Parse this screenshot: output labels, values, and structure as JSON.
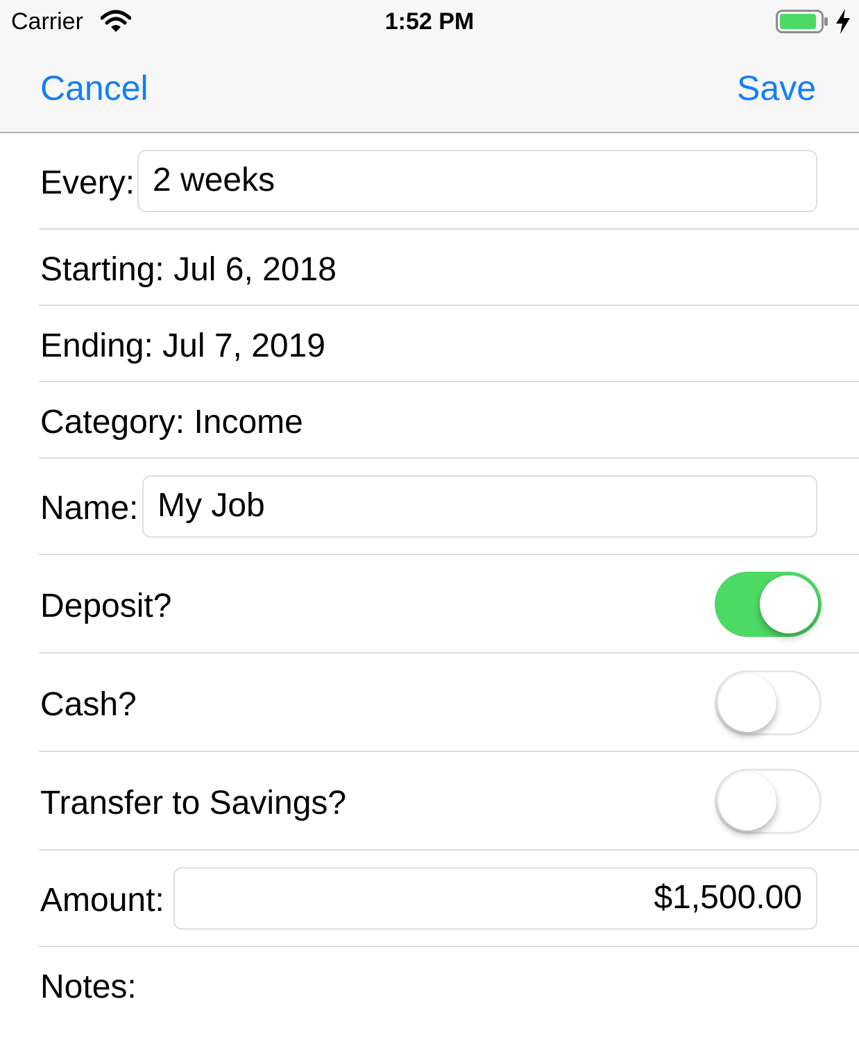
{
  "status": {
    "carrier": "Carrier",
    "time": "1:52 PM"
  },
  "nav": {
    "cancel": "Cancel",
    "save": "Save"
  },
  "form": {
    "every": {
      "label": "Every:",
      "value": "2 weeks"
    },
    "starting": {
      "label": "Starting: Jul 6, 2018"
    },
    "ending": {
      "label": "Ending: Jul 7, 2019"
    },
    "category": {
      "label": "Category: Income"
    },
    "name": {
      "label": "Name:",
      "value": "My Job"
    },
    "deposit": {
      "label": "Deposit?",
      "on": true
    },
    "cash": {
      "label": "Cash?",
      "on": false
    },
    "transfer": {
      "label": "Transfer to Savings?",
      "on": false
    },
    "amount": {
      "label": "Amount:",
      "value": "$1,500.00"
    },
    "notes": {
      "label": "Notes:"
    }
  },
  "colors": {
    "accent": "#147efb",
    "toggle_on": "#4cd964",
    "battery": "#4cd964"
  }
}
